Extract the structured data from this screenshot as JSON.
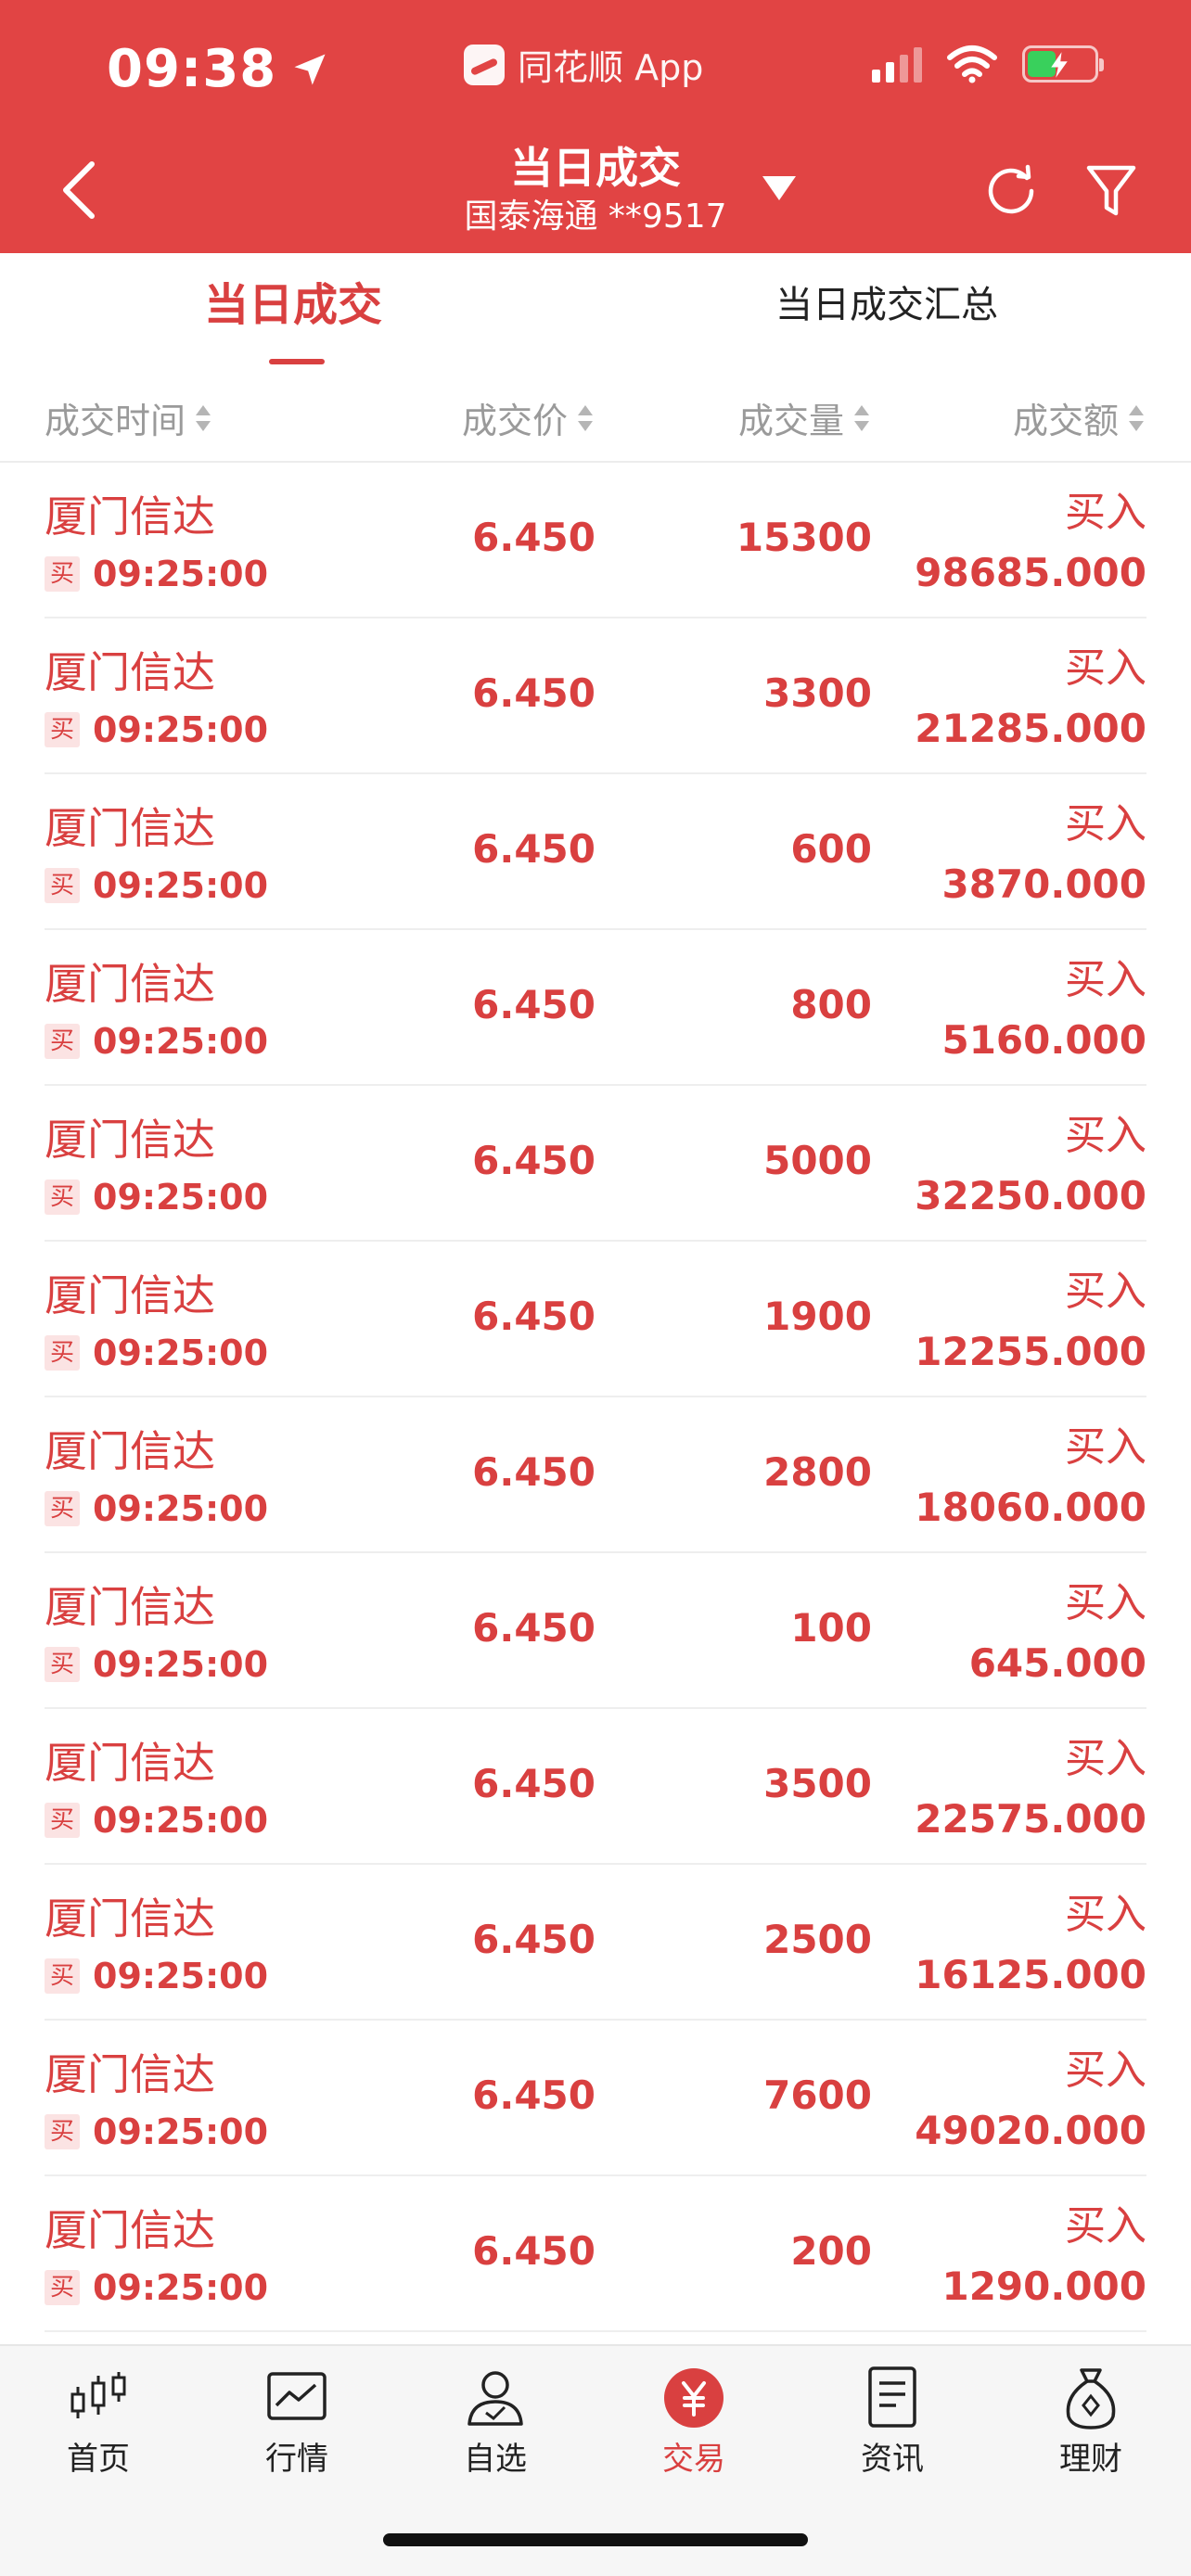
{
  "status_bar": {
    "time": "09:38",
    "app_name": "同花顺 App"
  },
  "header": {
    "title": "当日成交",
    "account": "国泰海通 **9517"
  },
  "tabs": [
    {
      "label": "当日成交",
      "active": true
    },
    {
      "label": "当日成交汇总",
      "active": false
    }
  ],
  "columns": {
    "time": "成交时间",
    "price": "成交价",
    "qty": "成交量",
    "amount": "成交额"
  },
  "trades": [
    {
      "name": "厦门信达",
      "tag": "买",
      "time": "09:25:00",
      "price": "6.450",
      "qty": "15300",
      "direction": "买入",
      "amount": "98685.000"
    },
    {
      "name": "厦门信达",
      "tag": "买",
      "time": "09:25:00",
      "price": "6.450",
      "qty": "3300",
      "direction": "买入",
      "amount": "21285.000"
    },
    {
      "name": "厦门信达",
      "tag": "买",
      "time": "09:25:00",
      "price": "6.450",
      "qty": "600",
      "direction": "买入",
      "amount": "3870.000"
    },
    {
      "name": "厦门信达",
      "tag": "买",
      "time": "09:25:00",
      "price": "6.450",
      "qty": "800",
      "direction": "买入",
      "amount": "5160.000"
    },
    {
      "name": "厦门信达",
      "tag": "买",
      "time": "09:25:00",
      "price": "6.450",
      "qty": "5000",
      "direction": "买入",
      "amount": "32250.000"
    },
    {
      "name": "厦门信达",
      "tag": "买",
      "time": "09:25:00",
      "price": "6.450",
      "qty": "1900",
      "direction": "买入",
      "amount": "12255.000"
    },
    {
      "name": "厦门信达",
      "tag": "买",
      "time": "09:25:00",
      "price": "6.450",
      "qty": "2800",
      "direction": "买入",
      "amount": "18060.000"
    },
    {
      "name": "厦门信达",
      "tag": "买",
      "time": "09:25:00",
      "price": "6.450",
      "qty": "100",
      "direction": "买入",
      "amount": "645.000"
    },
    {
      "name": "厦门信达",
      "tag": "买",
      "time": "09:25:00",
      "price": "6.450",
      "qty": "3500",
      "direction": "买入",
      "amount": "22575.000"
    },
    {
      "name": "厦门信达",
      "tag": "买",
      "time": "09:25:00",
      "price": "6.450",
      "qty": "2500",
      "direction": "买入",
      "amount": "16125.000"
    },
    {
      "name": "厦门信达",
      "tag": "买",
      "time": "09:25:00",
      "price": "6.450",
      "qty": "7600",
      "direction": "买入",
      "amount": "49020.000"
    },
    {
      "name": "厦门信达",
      "tag": "买",
      "time": "09:25:00",
      "price": "6.450",
      "qty": "200",
      "direction": "买入",
      "amount": "1290.000"
    }
  ],
  "nav": [
    {
      "label": "首页",
      "icon": "candlestick-icon",
      "active": false
    },
    {
      "label": "行情",
      "icon": "chart-icon",
      "active": false
    },
    {
      "label": "自选",
      "icon": "user-icon",
      "active": false
    },
    {
      "label": "交易",
      "icon": "yuan-icon",
      "active": true
    },
    {
      "label": "资讯",
      "icon": "document-icon",
      "active": false
    },
    {
      "label": "理财",
      "icon": "money-bag-icon",
      "active": false
    }
  ],
  "colors": {
    "header_bg": "#e14444",
    "accent_red": "#d94040",
    "battery_green": "#39d05c"
  }
}
